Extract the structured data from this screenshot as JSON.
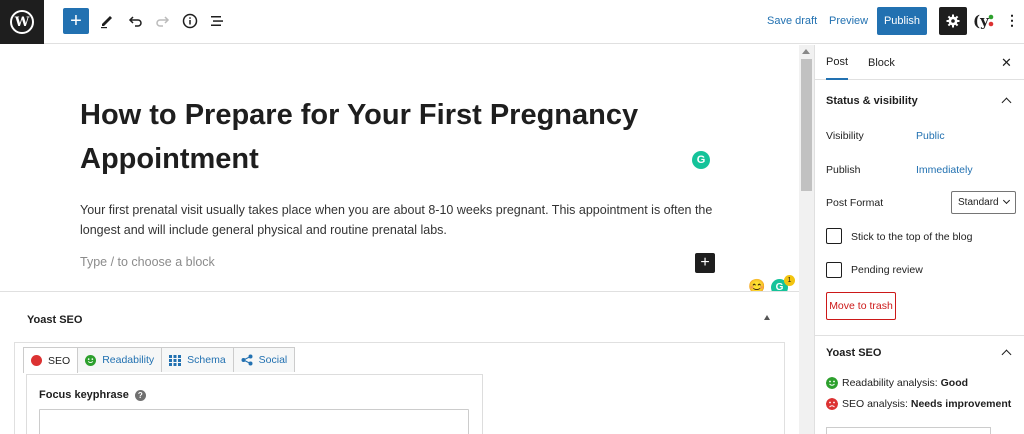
{
  "toolbar": {
    "logo_glyph": "W",
    "add_block_glyph": "+",
    "save_draft_label": "Save draft",
    "preview_label": "Preview",
    "publish_label": "Publish",
    "more_glyph": "⋮",
    "icons": [
      "wordpress-icon",
      "plus-icon",
      "pen-icon",
      "undo-icon",
      "redo-icon",
      "info-icon",
      "list-view-icon",
      "gear-icon",
      "yoast-icon",
      "more-vertical-icon"
    ]
  },
  "editor": {
    "title": "How to Prepare for Your First Pregnancy Appointment",
    "grammarly_glyph": "G",
    "paragraph": "Your first prenatal visit usually takes place when you are about 8-10 weeks pregnant. This appointment is often the longest and will include general physical and routine prenatal labs.",
    "block_placeholder": "Type / to choose a block",
    "block_add_glyph": "+",
    "grammarly_badge_glyph": "G",
    "grammarly_count": "1"
  },
  "yoast_metabox": {
    "title": "Yoast SEO",
    "tabs": [
      {
        "label": "SEO",
        "icon": "red-dot-icon"
      },
      {
        "label": "Readability",
        "icon": "green-smiley-icon"
      },
      {
        "label": "Schema",
        "icon": "grid-icon"
      },
      {
        "label": "Social",
        "icon": "share-icon"
      }
    ],
    "focus_keyphrase_label": "Focus keyphrase",
    "help_glyph": "?"
  },
  "sidebar": {
    "tabs": [
      "Post",
      "Block"
    ],
    "close_glyph": "✕",
    "status_title": "Status & visibility",
    "visibility_label": "Visibility",
    "visibility_value": "Public",
    "publish_label": "Publish",
    "publish_value": "Immediately",
    "post_format_label": "Post Format",
    "post_format_value": "Standard",
    "stick_label": "Stick to the top of the blog",
    "pending_label": "Pending review",
    "trash_label": "Move to trash",
    "yoast_title": "Yoast SEO",
    "readability_prefix": "Readability analysis:",
    "readability_value": "Good",
    "seo_prefix": "SEO analysis:",
    "seo_value": "Needs improvement"
  },
  "colors": {
    "accent": "#2271b1",
    "dark": "#1e1e1e",
    "grammarly": "#15c39a",
    "seo_bad": "#dc3232",
    "readability_good": "#2da02d",
    "trash": "#cc1818"
  }
}
